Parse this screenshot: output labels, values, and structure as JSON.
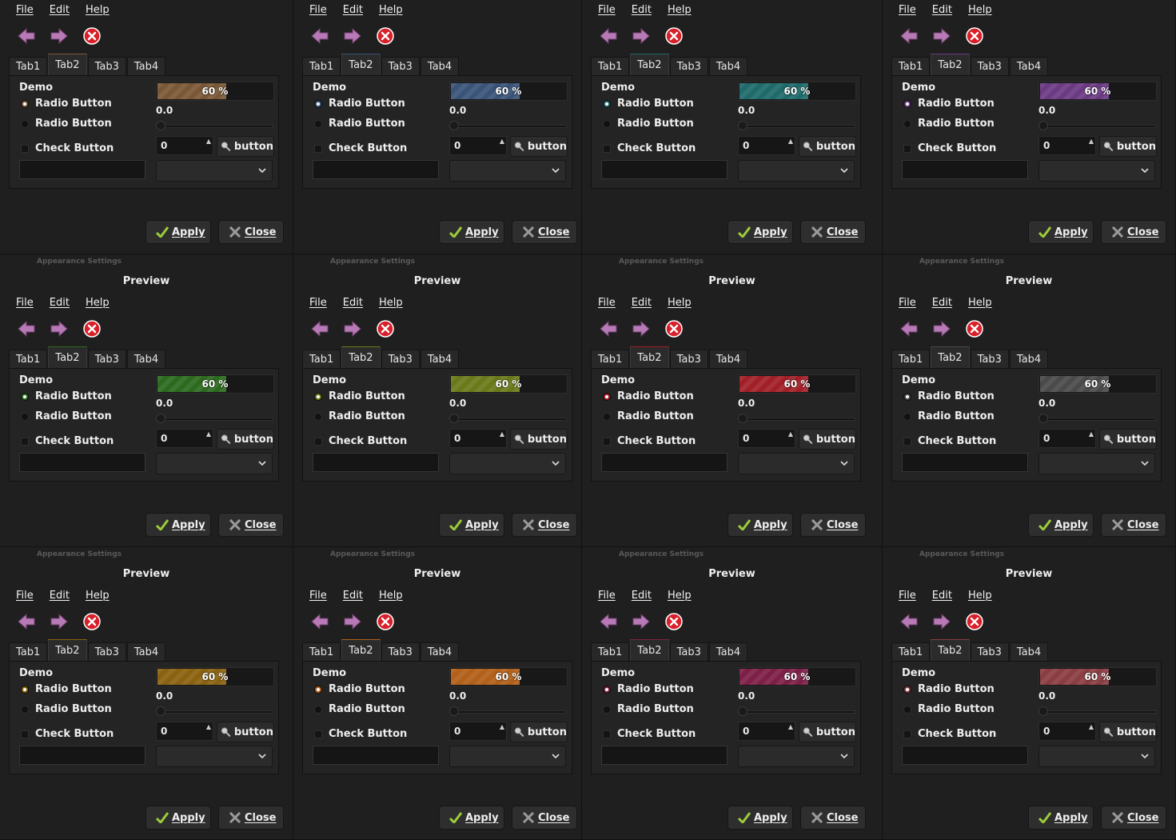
{
  "window": {
    "appearance_title": "Appearance Settings",
    "preview_label": "Preview"
  },
  "menu": [
    "File",
    "Edit",
    "Help"
  ],
  "toolbar": {
    "back_icon": "arrow-left-icon",
    "forward_icon": "arrow-right-icon",
    "stop_icon": "stop-icon"
  },
  "tabs": [
    "Tab1",
    "Tab2",
    "Tab3",
    "Tab4"
  ],
  "active_tab_index": 1,
  "demo": {
    "frame_label": "Demo",
    "radio_1": "Radio Button",
    "radio_2": "Radio Button",
    "check": "Check Button",
    "progress_text": "60 %",
    "progress_fraction": 0.6,
    "scale_value": "0.0",
    "spin_value": "0",
    "search_button": "button"
  },
  "actions": {
    "apply": "Apply",
    "close": "Close"
  },
  "themes": [
    {
      "accent": "#7a5836"
    },
    {
      "accent": "#3a5478"
    },
    {
      "accent": "#1f6a6a"
    },
    {
      "accent": "#6b3a83"
    },
    {
      "accent": "#2c6a1e"
    },
    {
      "accent": "#6a7a1a"
    },
    {
      "accent": "#a21f28"
    },
    {
      "accent": "#4a4a4a"
    },
    {
      "accent": "#8a6210"
    },
    {
      "accent": "#b2601a"
    },
    {
      "accent": "#7d1f47"
    },
    {
      "accent": "#8a3d42"
    }
  ]
}
